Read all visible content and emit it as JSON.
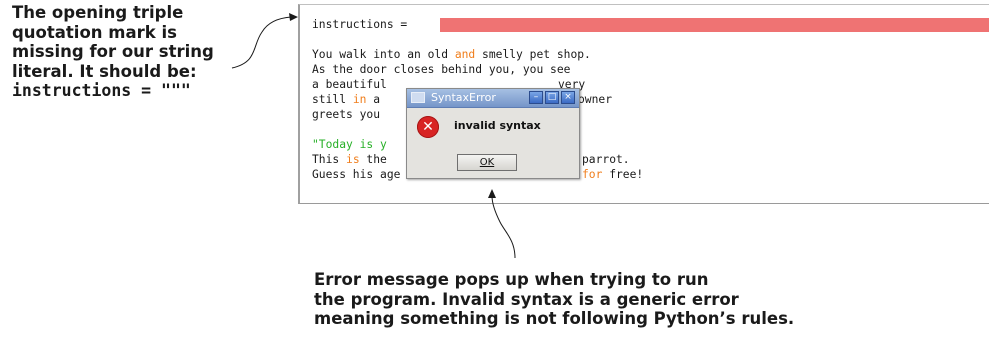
{
  "left_annotation": {
    "lines": [
      "The opening triple",
      "quotation mark is",
      "missing for our string",
      "literal. It should be:"
    ],
    "code": "instructions = \"\"\""
  },
  "bottom_annotation": {
    "lines": [
      "Error message pops up when trying to run",
      "the program. Invalid syntax is a generic error",
      "meaning something is not following Python’s rules."
    ]
  },
  "editor": {
    "line1": "instructions = ",
    "l2": {
      "a": "You walk into an old ",
      "k": "and",
      "b": " smelly pet shop."
    },
    "l3": "As the door closes behind you, you see",
    "l4": {
      "a": "a beautiful",
      "b": "very"
    },
    "l5": {
      "a": "still ",
      "k": "in",
      "b": " a",
      "c": "owner"
    },
    "l6": "greets you",
    "l7": "\"Today is y",
    "l8": {
      "a": "This ",
      "k": "is",
      "b": " the",
      "c": "parrot."
    },
    "l9": {
      "a": "Guess his age",
      "k": "for",
      "b": " free!"
    }
  },
  "dialog": {
    "title": "SyntaxError",
    "message": "invalid syntax",
    "ok_label": "OK",
    "buttons": {
      "minimize": "–",
      "maximize": "□",
      "close": "×"
    },
    "error_icon_glyph": "✕"
  },
  "colors": {
    "error_highlight": "#ef7373",
    "keyword": "#f07e1c",
    "string": "#27b027"
  }
}
